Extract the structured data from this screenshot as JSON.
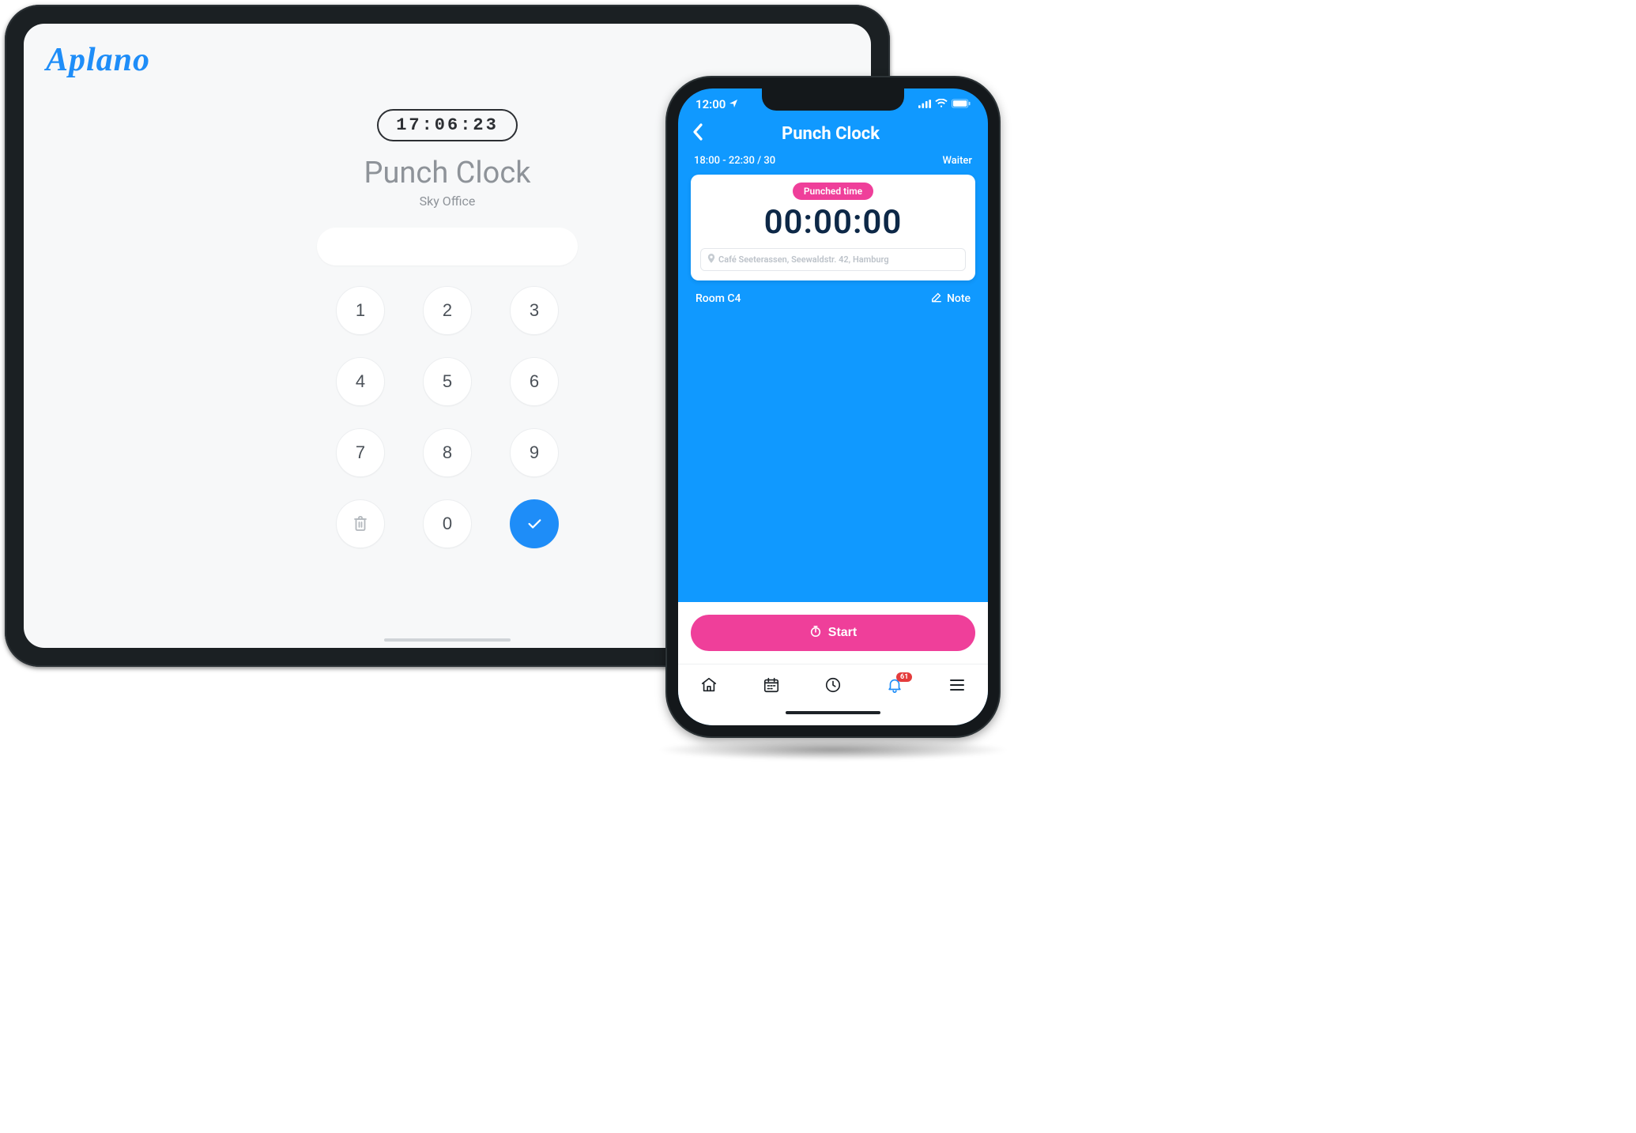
{
  "tablet": {
    "brand": "Aplano",
    "current_time": "17:06:23",
    "title": "Punch Clock",
    "subtitle": "Sky Office",
    "keypad": {
      "digits": [
        "1",
        "2",
        "3",
        "4",
        "5",
        "6",
        "7",
        "8",
        "9",
        "0"
      ]
    }
  },
  "phone": {
    "status_time": "12:00",
    "header_title": "Punch Clock",
    "shift_time": "18:00 - 22:30 / 30",
    "role": "Waiter",
    "badge_label": "Punched time",
    "timer": "00:00:00",
    "location": "Café Seeterassen, Seewaldstr. 42, Hamburg",
    "room": "Room C4",
    "note_label": "Note",
    "start_label": "Start",
    "nav_badge_count": "61"
  },
  "colors": {
    "brand_blue": "#1e8df8",
    "phone_blue": "#1099ff",
    "pink": "#ef3f9a"
  }
}
